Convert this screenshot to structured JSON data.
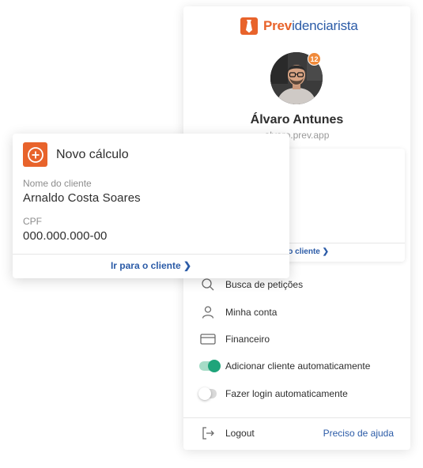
{
  "brand": {
    "name_part1": "Prev",
    "name_part2": "idenciarista",
    "color_orange": "#e8632b",
    "color_blue": "#2b5ba7"
  },
  "profile": {
    "notification_count": "12",
    "name": "Álvaro Antunes",
    "subtitle": "alvaro.prev.app"
  },
  "inner_card": {
    "link_fragment": "o cliente ❯"
  },
  "menu": [
    {
      "label": "Busca de petições",
      "icon": "search-icon"
    },
    {
      "label": "Minha conta",
      "icon": "user-icon"
    },
    {
      "label": "Financeiro",
      "icon": "credit-card-icon"
    },
    {
      "label": "Adicionar cliente automaticamente",
      "icon": "toggle-on"
    },
    {
      "label": "Fazer login automaticamente",
      "icon": "toggle-off"
    }
  ],
  "footer": {
    "logout_label": "Logout",
    "help_label": "Preciso de ajuda"
  },
  "card": {
    "title": "Novo cálculo",
    "client_label": "Nome do cliente",
    "client_value": "Arnaldo Costa Soares",
    "cpf_label": "CPF",
    "cpf_value": "000.000.000-00",
    "link_label": "Ir para o cliente ❯"
  },
  "colors": {
    "accent_green": "#1fa47a",
    "link_blue": "#2b5ba7",
    "badge_orange": "#f08a3a"
  }
}
